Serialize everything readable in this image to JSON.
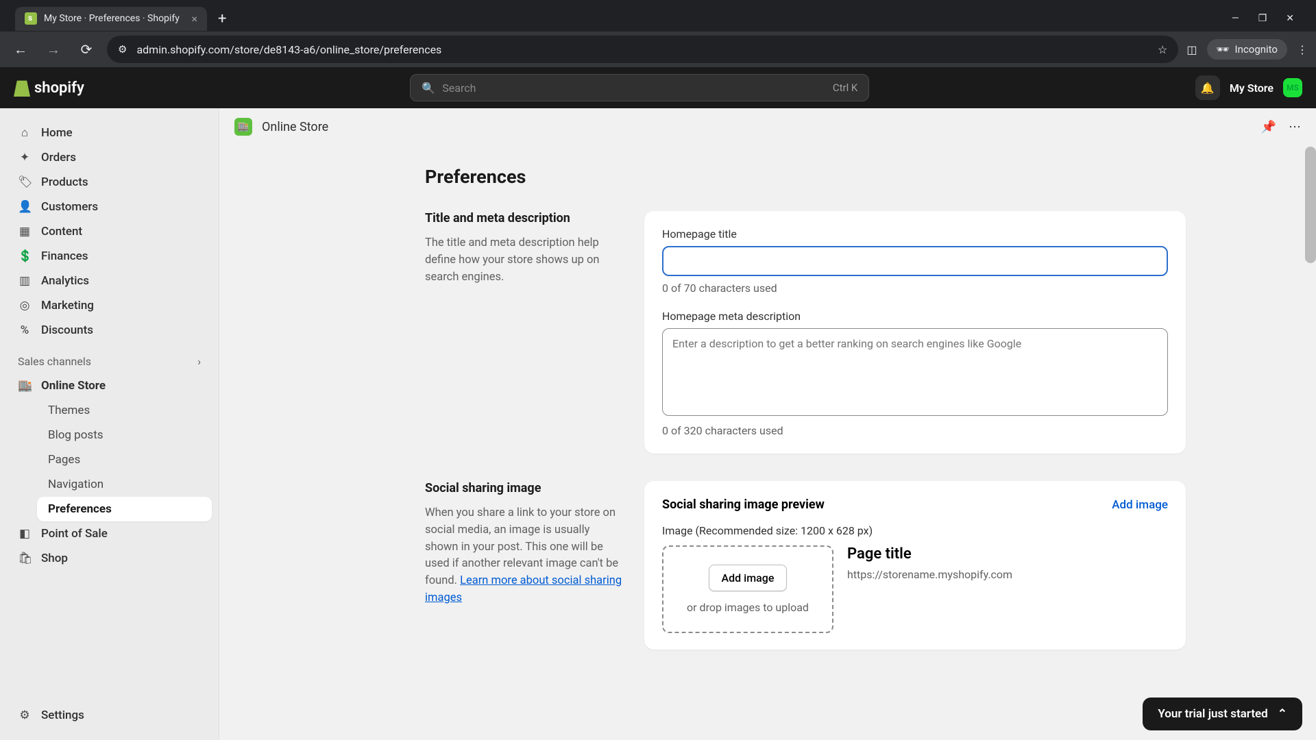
{
  "browser": {
    "tab_title": "My Store · Preferences · Shopify",
    "url": "admin.shopify.com/store/de8143-a6/online_store/preferences",
    "incognito_label": "Incognito"
  },
  "header": {
    "search_placeholder": "Search",
    "search_shortcut": "Ctrl K",
    "store_name": "My Store",
    "store_initials": "MS"
  },
  "sidebar": {
    "items": [
      {
        "label": "Home",
        "icon": "⌂"
      },
      {
        "label": "Orders",
        "icon": "✦"
      },
      {
        "label": "Products",
        "icon": "🏷"
      },
      {
        "label": "Customers",
        "icon": "👤"
      },
      {
        "label": "Content",
        "icon": "▦"
      },
      {
        "label": "Finances",
        "icon": "💲"
      },
      {
        "label": "Analytics",
        "icon": "▥"
      },
      {
        "label": "Marketing",
        "icon": "◎"
      },
      {
        "label": "Discounts",
        "icon": "%"
      }
    ],
    "section_label": "Sales channels",
    "online_store": {
      "label": "Online Store",
      "sub": [
        "Themes",
        "Blog posts",
        "Pages",
        "Navigation",
        "Preferences"
      ]
    },
    "pos_label": "Point of Sale",
    "shop_label": "Shop",
    "settings_label": "Settings"
  },
  "page": {
    "channel_label": "Online Store",
    "title": "Preferences",
    "section1": {
      "heading": "Title and meta description",
      "desc": "The title and meta description help define how your store shows up on search engines.",
      "title_label": "Homepage title",
      "title_hint": "0 of 70 characters used",
      "meta_label": "Homepage meta description",
      "meta_placeholder": "Enter a description to get a better ranking on search engines like Google",
      "meta_hint": "0 of 320 characters used"
    },
    "section2": {
      "heading": "Social sharing image",
      "desc_pre": "When you share a link to your store on social media, an image is usually shown in your post. This one will be used if another relevant image can't be found. ",
      "desc_link": "Learn more about social sharing images",
      "card_title": "Social sharing image preview",
      "add_link": "Add image",
      "rec": "Image  (Recommended size: 1200 x 628 px)",
      "add_btn": "Add image",
      "drop_text": "or drop images to upload",
      "preview_title": "Page title",
      "preview_url": "https://storename.myshopify.com"
    },
    "trial_label": "Your trial just started"
  }
}
